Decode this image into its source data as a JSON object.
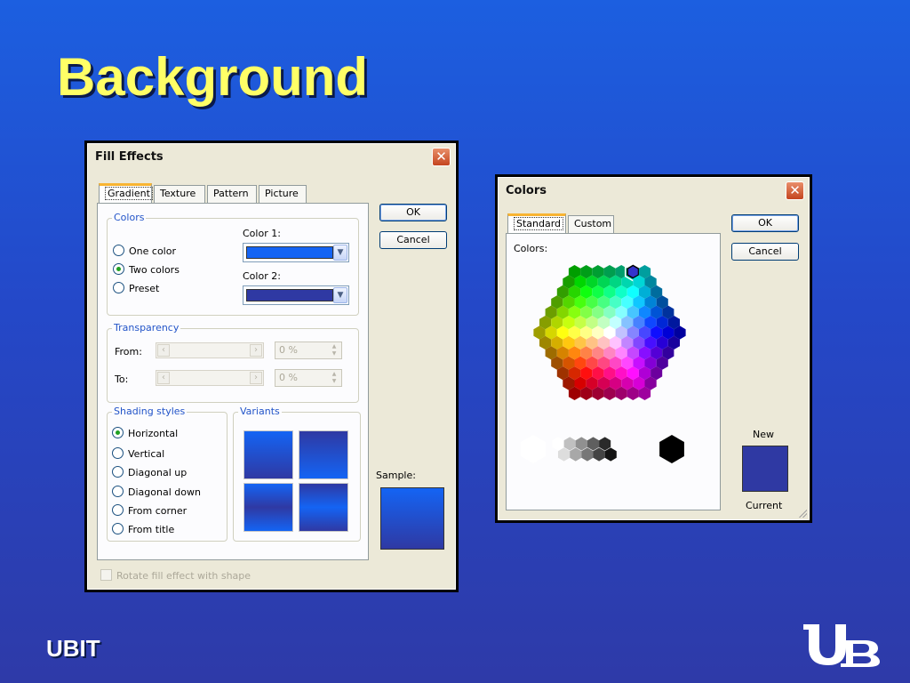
{
  "slide": {
    "title": "Background",
    "footer": "UBIT",
    "logo": "ub-logo",
    "colors": {
      "title": "#ffff66",
      "background_top": "#1c5fe0",
      "background_bottom": "#2e3aa8"
    }
  },
  "fill_effects": {
    "title": "Fill Effects",
    "close_glyph": "✕",
    "tabs": [
      {
        "label": "Gradient",
        "active": true
      },
      {
        "label": "Texture",
        "active": false
      },
      {
        "label": "Pattern",
        "active": false
      },
      {
        "label": "Picture",
        "active": false
      }
    ],
    "ok_label": "OK",
    "cancel_label": "Cancel",
    "colors_group": {
      "legend": "Colors",
      "radios": [
        {
          "label": "One color",
          "selected": false
        },
        {
          "label": "Two colors",
          "selected": true
        },
        {
          "label": "Preset",
          "selected": false
        }
      ],
      "color1_label": "Color 1:",
      "color1_value": "#1464f4",
      "color2_label": "Color 2:",
      "color2_value": "#2f39a3"
    },
    "transparency_group": {
      "legend": "Transparency",
      "from_label": "From:",
      "from_value": "0 %",
      "to_label": "To:",
      "to_value": "0 %"
    },
    "shading_group": {
      "legend": "Shading styles",
      "radios": [
        {
          "label": "Horizontal",
          "selected": true
        },
        {
          "label": "Vertical",
          "selected": false
        },
        {
          "label": "Diagonal up",
          "selected": false
        },
        {
          "label": "Diagonal down",
          "selected": false
        },
        {
          "label": "From corner",
          "selected": false
        },
        {
          "label": "From title",
          "selected": false
        }
      ]
    },
    "variants_legend": "Variants",
    "sample_label": "Sample:",
    "rotate_label": "Rotate fill effect with shape"
  },
  "colors_dialog": {
    "title": "Colors",
    "close_glyph": "✕",
    "tabs": [
      {
        "label": "Standard",
        "active": true
      },
      {
        "label": "Custom",
        "active": false
      }
    ],
    "colors_label": "Colors:",
    "ok_label": "OK",
    "cancel_label": "Cancel",
    "new_label": "New",
    "current_label": "Current",
    "new_color": "#2f39a3",
    "selected_color": "#3333cc"
  }
}
